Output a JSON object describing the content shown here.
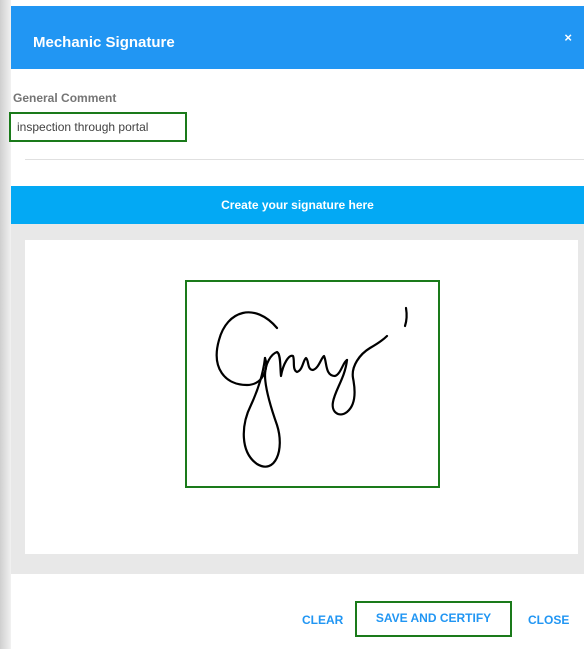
{
  "dialog": {
    "title": "Mechanic Signature",
    "close_icon": "close-icon",
    "close_glyph": "×"
  },
  "comment": {
    "label": "General Comment",
    "value": "inspection through portal"
  },
  "signature": {
    "banner": "Create your signature here"
  },
  "footer": {
    "clear_label": "CLEAR",
    "save_label": "SAVE AND CERTIFY",
    "close_label": "CLOSE"
  },
  "colors": {
    "header": "#2196f3",
    "banner": "#03a9f4",
    "highlight": "#1a7a1a",
    "button_text": "#2196f3"
  }
}
